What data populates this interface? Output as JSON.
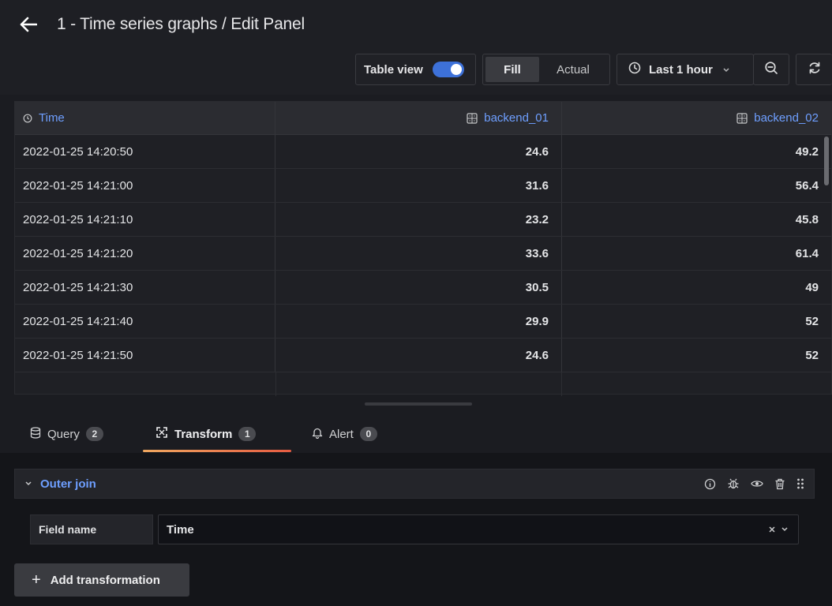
{
  "header": {
    "title": "1 - Time series graphs / Edit Panel",
    "back_icon": "arrow-left-icon"
  },
  "toolbar": {
    "table_view_label": "Table view",
    "table_view_enabled": true,
    "fill_label": "Fill",
    "actual_label": "Actual",
    "time_range_label": "Last 1 hour",
    "accent_color": "#3d71d9"
  },
  "table": {
    "columns": [
      "Time",
      "backend_01",
      "backend_02"
    ],
    "rows": [
      [
        "2022-01-25 14:20:50",
        "24.6",
        "49.2"
      ],
      [
        "2022-01-25 14:21:00",
        "31.6",
        "56.4"
      ],
      [
        "2022-01-25 14:21:10",
        "23.2",
        "45.8"
      ],
      [
        "2022-01-25 14:21:20",
        "33.6",
        "61.4"
      ],
      [
        "2022-01-25 14:21:30",
        "30.5",
        "49"
      ],
      [
        "2022-01-25 14:21:40",
        "29.9",
        "52"
      ],
      [
        "2022-01-25 14:21:50",
        "24.6",
        "52"
      ]
    ],
    "header_color": "#6e9fff"
  },
  "tabs": [
    {
      "label": "Query",
      "count": "2"
    },
    {
      "label": "Transform",
      "count": "1"
    },
    {
      "label": "Alert",
      "count": "0"
    }
  ],
  "transformation": {
    "name": "Outer join",
    "field_label": "Field name",
    "field_value": "Time"
  },
  "add_transformation_label": "Add transformation"
}
